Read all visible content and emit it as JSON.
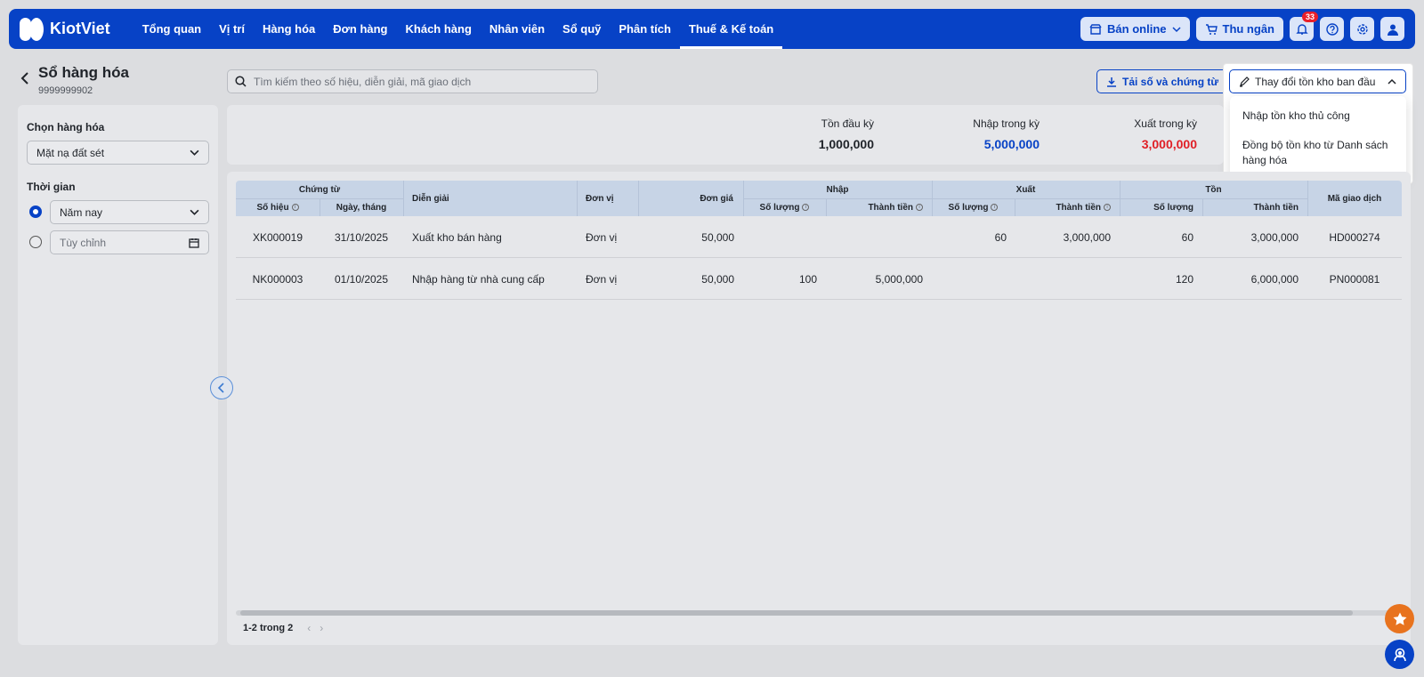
{
  "app": {
    "brand": "KiotViet",
    "nav": [
      "Tổng quan",
      "Vị trí",
      "Hàng hóa",
      "Đơn hàng",
      "Khách hàng",
      "Nhân viên",
      "Sổ quỹ",
      "Phân tích",
      "Thuế & Kế toán"
    ],
    "active_nav": "Thuế & Kế toán",
    "sell_online": "Bán online",
    "cashier": "Thu ngân",
    "notification_count": "33",
    "brand_color": "#0742c6"
  },
  "page": {
    "title": "Sổ hàng hóa",
    "code": "9999999902",
    "search_placeholder": "Tìm kiếm theo số hiệu, diễn giải, mã giao dịch",
    "download_label": "Tải số và chứng từ",
    "change_label": "Thay đổi tồn kho ban đầu",
    "dropdown": [
      "Nhập tồn kho thủ công",
      "Đồng bộ tồn kho từ Danh sách hàng hóa"
    ]
  },
  "sidebar": {
    "product_label": "Chọn hàng hóa",
    "product_value": "Mặt nạ đất sét",
    "time_label": "Thời gian",
    "time_option": "Năm nay",
    "custom_placeholder": "Tùy chỉnh"
  },
  "summary": [
    {
      "label": "Tồn đầu kỳ",
      "value": "1,000,000",
      "color": "#1f2329"
    },
    {
      "label": "Nhập trong kỳ",
      "value": "5,000,000",
      "color": "#0742c6"
    },
    {
      "label": "Xuất trong kỳ",
      "value": "3,000,000",
      "color": "#e01f26"
    }
  ],
  "table": {
    "groups": {
      "voucher": "Chứng từ",
      "import": "Nhập",
      "export": "Xuất",
      "stock": "Tồn"
    },
    "headers": {
      "number": "Số hiệu",
      "date": "Ngày, tháng",
      "description": "Diễn giải",
      "unit": "Đơn vị",
      "price": "Đơn giá",
      "qty": "Số lượng",
      "amount": "Thành tiền",
      "txn": "Mã giao dịch"
    },
    "rows": [
      {
        "number": "XK000019",
        "date": "31/10/2025",
        "description": "Xuất kho bán hàng",
        "unit": "Đơn vị",
        "price": "50,000",
        "in_qty": "",
        "in_amount": "",
        "out_qty": "60",
        "out_amount": "3,000,000",
        "stock_qty": "60",
        "stock_amount": "3,000,000",
        "txn": "HD000274"
      },
      {
        "number": "NK000003",
        "date": "01/10/2025",
        "description": "Nhập hàng từ nhà cung cấp",
        "unit": "Đơn vị",
        "price": "50,000",
        "in_qty": "100",
        "in_amount": "5,000,000",
        "out_qty": "",
        "out_amount": "",
        "stock_qty": "120",
        "stock_amount": "6,000,000",
        "txn": "PN000081"
      }
    ],
    "pagination": "1-2 trong 2"
  }
}
